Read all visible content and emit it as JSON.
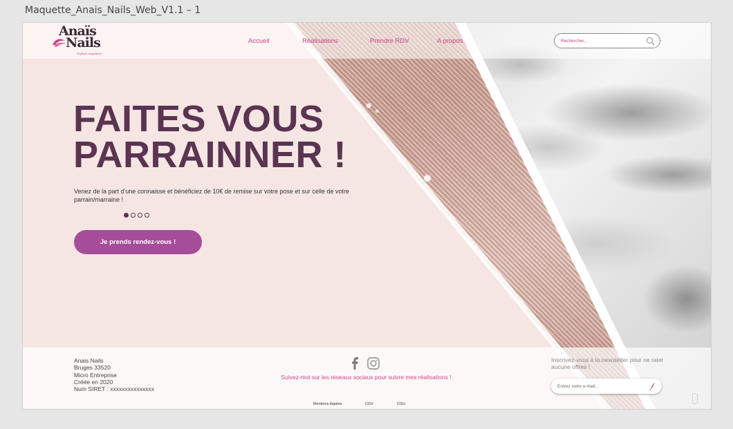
{
  "window": {
    "title": "Maquette_Anais_Nails_Web_V1.1 – 1"
  },
  "logo": {
    "line1": "Anaïs",
    "line2": "Nails",
    "tagline": "Styliste ongulaire"
  },
  "nav": [
    {
      "label": "Accueil"
    },
    {
      "label": "Réalisations"
    },
    {
      "label": "Prendre RDV"
    },
    {
      "label": "A propos"
    }
  ],
  "search": {
    "placeholder": "Rechercher..."
  },
  "hero": {
    "title_line1": "FAITES VOUS",
    "title_line2": "PARRAINNER !",
    "text": "Venez de la part d'une connaisse et bénéficiez de 10€ de remise sur votre pose et sur celle de votre parrain/marraine !",
    "slides": 4,
    "active_slide": 1,
    "cta_label": "Je prends rendez-vous !"
  },
  "footer": {
    "company": [
      "Anais Nails",
      "Bruges 33520",
      "Micro Entreprise",
      "Créée en 2020",
      "Num SIRET : xxxxxxxxxxxxxxx"
    ],
    "social_text": "Suivez-moi sur les réseaux sociaux pour suivre mes réalisations !",
    "legal": [
      {
        "label": "Mentions légales"
      },
      {
        "label": "CGV"
      },
      {
        "label": "CGU"
      }
    ],
    "newsletter_text": "Inscrivez-vous à la newsletter pour ne rater aucune offres !",
    "email_placeholder": "Entrez votre e-mail..."
  },
  "colors": {
    "accent": "#d0438a",
    "title": "#5a3451",
    "cta": "#a54d9b",
    "background": "#f5e6e4"
  }
}
